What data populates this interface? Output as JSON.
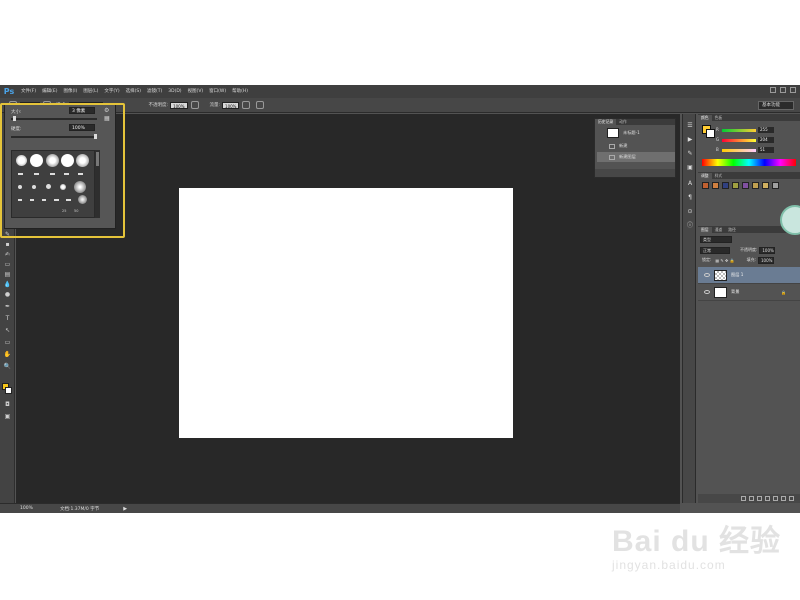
{
  "app": {
    "logo": "Ps",
    "menu": [
      "文件(F)",
      "编辑(E)",
      "图像(I)",
      "图层(L)",
      "文字(Y)",
      "选择(S)",
      "滤镜(T)",
      "3D(D)",
      "视图(V)",
      "窗口(W)",
      "帮助(H)"
    ]
  },
  "options_bar": {
    "brush_size": "3",
    "mode_label": "模式:",
    "mode_value": "正常",
    "opacity_label": "不透明度:",
    "opacity_value": "100%",
    "flow_label": "流量:",
    "flow_value": "100%",
    "workspace": "基本功能"
  },
  "brush_popup": {
    "size_label": "大小:",
    "size_value": "3 像素",
    "hardness_label": "硬度:",
    "hardness_value": "100%",
    "numbers": [
      "25",
      "50"
    ]
  },
  "status": {
    "zoom": "100%",
    "doc": "文档:1.37M/0 字节"
  },
  "history": {
    "tabs": [
      "历史记录",
      "动作"
    ],
    "snapshot": "未标题-1",
    "rows": [
      "新建",
      "新建图层"
    ]
  },
  "color": {
    "tabs": [
      "颜色",
      "色板"
    ],
    "r": "255",
    "g": "204",
    "b": "51",
    "fg": "#ffcc33",
    "bg": "#ffffff"
  },
  "adjustments": {
    "tabs": [
      "调整",
      "样式"
    ]
  },
  "layers": {
    "tabs": [
      "图层",
      "通道",
      "路径"
    ],
    "kind": "类型",
    "blend": "正常",
    "opacity_label": "不透明度:",
    "opacity_value": "100%",
    "lock_label": "锁定:",
    "fill_label": "填充:",
    "fill_value": "100%",
    "items": [
      {
        "name": "图层 1"
      },
      {
        "name": "背景"
      }
    ]
  },
  "watermark": {
    "main": "Bai du 经验",
    "sub": "jingyan.baidu.com"
  }
}
